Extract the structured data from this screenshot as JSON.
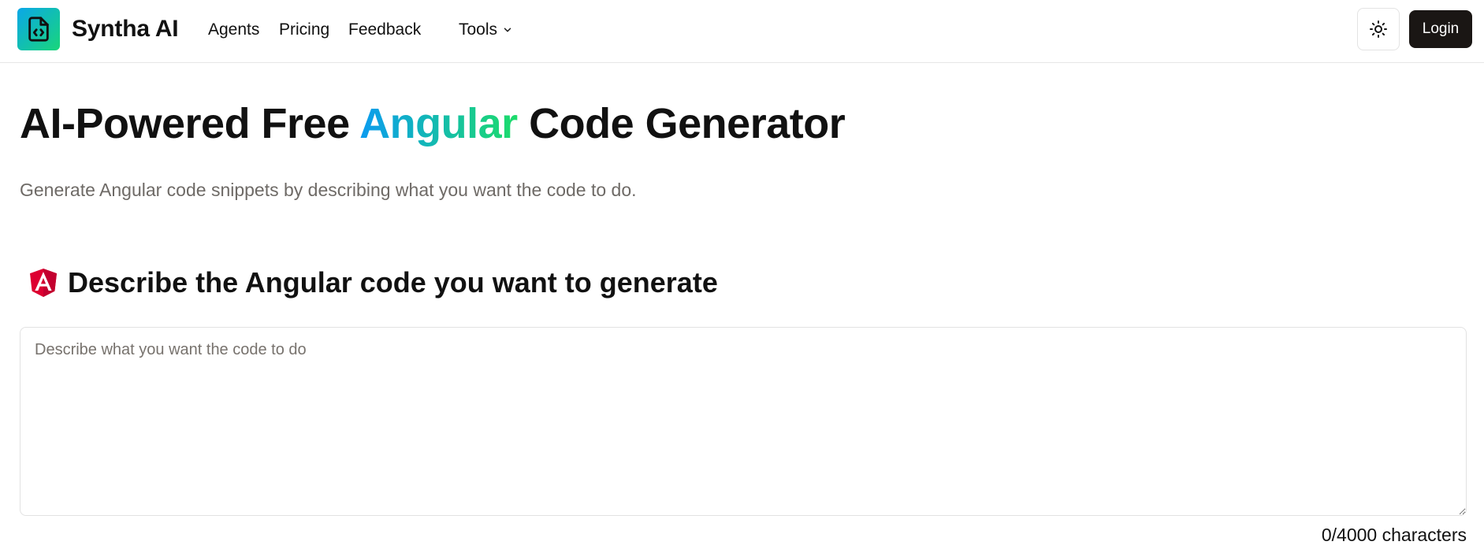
{
  "header": {
    "brand": "Syntha AI",
    "nav": {
      "agents": "Agents",
      "pricing": "Pricing",
      "feedback": "Feedback",
      "tools": "Tools"
    },
    "login_label": "Login",
    "logo_icon": "file-code-icon",
    "theme_icon": "sun-icon",
    "tools_icon": "chevron-down-icon"
  },
  "hero": {
    "title_before": "AI-Powered Free ",
    "title_accent": "Angular",
    "title_after": " Code Generator",
    "subtitle": "Generate Angular code snippets by describing what you want the code to do."
  },
  "prompt_section": {
    "icon": "angular-icon",
    "heading": "Describe the Angular code you want to generate",
    "placeholder": "Describe what you want the code to do",
    "value": "",
    "char_count": "0/4000 characters"
  },
  "colors": {
    "accent_start": "#0b9bf0",
    "accent_end": "#1ddc6a",
    "login_bg": "#1a1614",
    "angular_red": "#dd0031",
    "muted_text": "#6e6a66"
  }
}
